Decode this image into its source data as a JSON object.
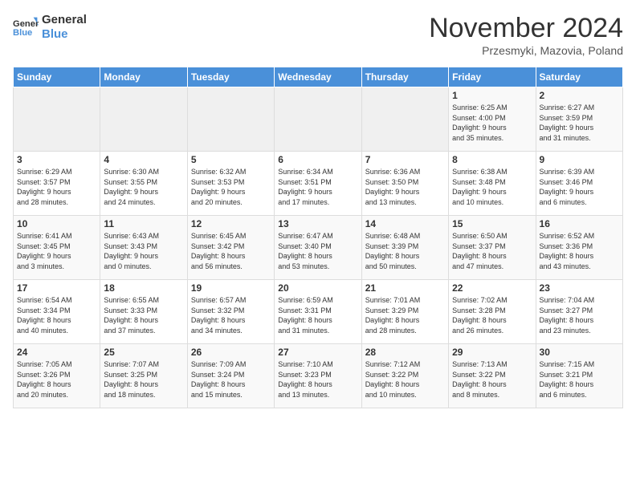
{
  "logo": {
    "line1": "General",
    "line2": "Blue"
  },
  "title": "November 2024",
  "subtitle": "Przesmyki, Mazovia, Poland",
  "days_of_week": [
    "Sunday",
    "Monday",
    "Tuesday",
    "Wednesday",
    "Thursday",
    "Friday",
    "Saturday"
  ],
  "weeks": [
    [
      {
        "day": "",
        "info": ""
      },
      {
        "day": "",
        "info": ""
      },
      {
        "day": "",
        "info": ""
      },
      {
        "day": "",
        "info": ""
      },
      {
        "day": "",
        "info": ""
      },
      {
        "day": "1",
        "info": "Sunrise: 6:25 AM\nSunset: 4:00 PM\nDaylight: 9 hours\nand 35 minutes."
      },
      {
        "day": "2",
        "info": "Sunrise: 6:27 AM\nSunset: 3:59 PM\nDaylight: 9 hours\nand 31 minutes."
      }
    ],
    [
      {
        "day": "3",
        "info": "Sunrise: 6:29 AM\nSunset: 3:57 PM\nDaylight: 9 hours\nand 28 minutes."
      },
      {
        "day": "4",
        "info": "Sunrise: 6:30 AM\nSunset: 3:55 PM\nDaylight: 9 hours\nand 24 minutes."
      },
      {
        "day": "5",
        "info": "Sunrise: 6:32 AM\nSunset: 3:53 PM\nDaylight: 9 hours\nand 20 minutes."
      },
      {
        "day": "6",
        "info": "Sunrise: 6:34 AM\nSunset: 3:51 PM\nDaylight: 9 hours\nand 17 minutes."
      },
      {
        "day": "7",
        "info": "Sunrise: 6:36 AM\nSunset: 3:50 PM\nDaylight: 9 hours\nand 13 minutes."
      },
      {
        "day": "8",
        "info": "Sunrise: 6:38 AM\nSunset: 3:48 PM\nDaylight: 9 hours\nand 10 minutes."
      },
      {
        "day": "9",
        "info": "Sunrise: 6:39 AM\nSunset: 3:46 PM\nDaylight: 9 hours\nand 6 minutes."
      }
    ],
    [
      {
        "day": "10",
        "info": "Sunrise: 6:41 AM\nSunset: 3:45 PM\nDaylight: 9 hours\nand 3 minutes."
      },
      {
        "day": "11",
        "info": "Sunrise: 6:43 AM\nSunset: 3:43 PM\nDaylight: 9 hours\nand 0 minutes."
      },
      {
        "day": "12",
        "info": "Sunrise: 6:45 AM\nSunset: 3:42 PM\nDaylight: 8 hours\nand 56 minutes."
      },
      {
        "day": "13",
        "info": "Sunrise: 6:47 AM\nSunset: 3:40 PM\nDaylight: 8 hours\nand 53 minutes."
      },
      {
        "day": "14",
        "info": "Sunrise: 6:48 AM\nSunset: 3:39 PM\nDaylight: 8 hours\nand 50 minutes."
      },
      {
        "day": "15",
        "info": "Sunrise: 6:50 AM\nSunset: 3:37 PM\nDaylight: 8 hours\nand 47 minutes."
      },
      {
        "day": "16",
        "info": "Sunrise: 6:52 AM\nSunset: 3:36 PM\nDaylight: 8 hours\nand 43 minutes."
      }
    ],
    [
      {
        "day": "17",
        "info": "Sunrise: 6:54 AM\nSunset: 3:34 PM\nDaylight: 8 hours\nand 40 minutes."
      },
      {
        "day": "18",
        "info": "Sunrise: 6:55 AM\nSunset: 3:33 PM\nDaylight: 8 hours\nand 37 minutes."
      },
      {
        "day": "19",
        "info": "Sunrise: 6:57 AM\nSunset: 3:32 PM\nDaylight: 8 hours\nand 34 minutes."
      },
      {
        "day": "20",
        "info": "Sunrise: 6:59 AM\nSunset: 3:31 PM\nDaylight: 8 hours\nand 31 minutes."
      },
      {
        "day": "21",
        "info": "Sunrise: 7:01 AM\nSunset: 3:29 PM\nDaylight: 8 hours\nand 28 minutes."
      },
      {
        "day": "22",
        "info": "Sunrise: 7:02 AM\nSunset: 3:28 PM\nDaylight: 8 hours\nand 26 minutes."
      },
      {
        "day": "23",
        "info": "Sunrise: 7:04 AM\nSunset: 3:27 PM\nDaylight: 8 hours\nand 23 minutes."
      }
    ],
    [
      {
        "day": "24",
        "info": "Sunrise: 7:05 AM\nSunset: 3:26 PM\nDaylight: 8 hours\nand 20 minutes."
      },
      {
        "day": "25",
        "info": "Sunrise: 7:07 AM\nSunset: 3:25 PM\nDaylight: 8 hours\nand 18 minutes."
      },
      {
        "day": "26",
        "info": "Sunrise: 7:09 AM\nSunset: 3:24 PM\nDaylight: 8 hours\nand 15 minutes."
      },
      {
        "day": "27",
        "info": "Sunrise: 7:10 AM\nSunset: 3:23 PM\nDaylight: 8 hours\nand 13 minutes."
      },
      {
        "day": "28",
        "info": "Sunrise: 7:12 AM\nSunset: 3:22 PM\nDaylight: 8 hours\nand 10 minutes."
      },
      {
        "day": "29",
        "info": "Sunrise: 7:13 AM\nSunset: 3:22 PM\nDaylight: 8 hours\nand 8 minutes."
      },
      {
        "day": "30",
        "info": "Sunrise: 7:15 AM\nSunset: 3:21 PM\nDaylight: 8 hours\nand 6 minutes."
      }
    ]
  ]
}
